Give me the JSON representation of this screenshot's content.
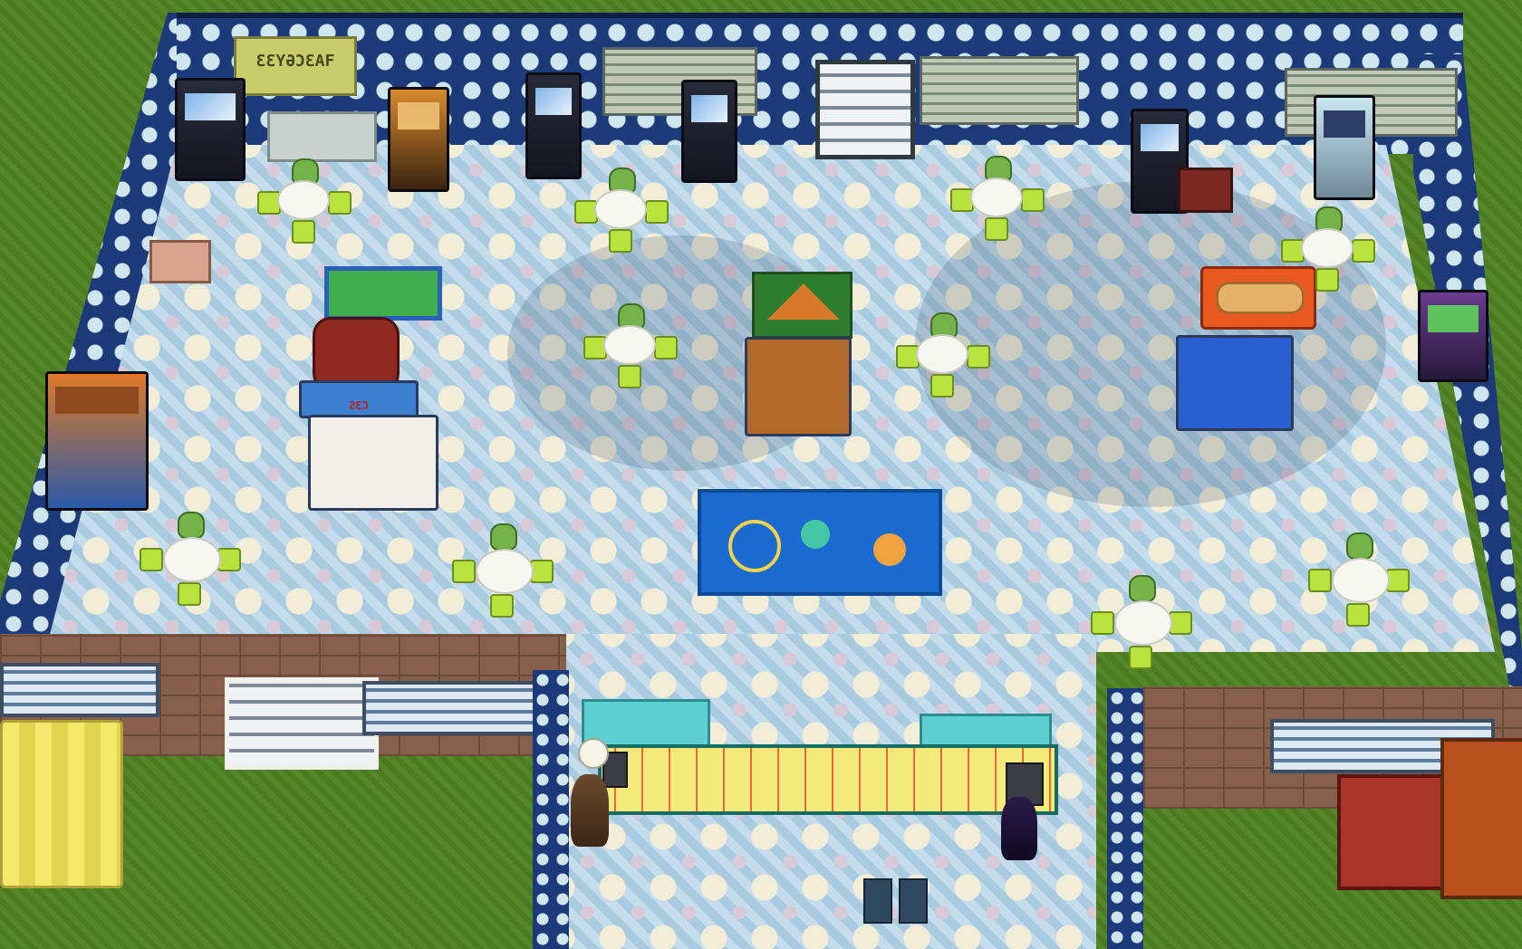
{
  "scene": {
    "sign_text": "ƐƐYƏƆƐAF",
    "stand_sign": "ƧƐƆ"
  },
  "colors": {
    "wall_blue": "#1c3a7a",
    "wall_dot": "#cfe6ee",
    "chair_green": "#b8e33e",
    "rug_blue": "#1c6bd0",
    "counter_yellow": "#f3ea7a",
    "cabinet_teal": "#5ecfd0"
  },
  "icons": {
    "thought_bubble": "smiley-flower-icon"
  }
}
